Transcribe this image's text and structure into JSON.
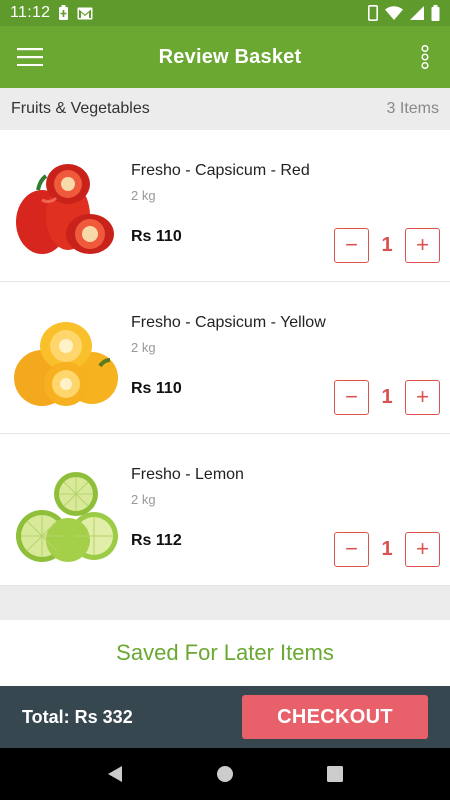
{
  "status_bar": {
    "time": "11:12",
    "icons": [
      "battery-saver-icon",
      "gmail-icon",
      "phone-icon",
      "wifi-icon",
      "signal-icon",
      "battery-icon"
    ]
  },
  "app_bar": {
    "title": "Review Basket",
    "menu_icon": "hamburger-menu-icon",
    "more_icon": "overflow-menu-icon"
  },
  "section": {
    "title": "Fruits & Vegetables",
    "count": "3 Items"
  },
  "items": [
    {
      "name": "Fresho - Capsicum - Red",
      "qty": "2 kg",
      "price": "Rs 110",
      "quantity": "1",
      "image": "red-capsicum-image"
    },
    {
      "name": "Fresho - Capsicum - Yellow",
      "qty": "2 kg",
      "price": "Rs 110",
      "quantity": "1",
      "image": "yellow-capsicum-image"
    },
    {
      "name": "Fresho - Lemon",
      "qty": "2 kg",
      "price": "Rs 112",
      "quantity": "1",
      "image": "lemon-image"
    }
  ],
  "stepper": {
    "minus": "−",
    "plus": "+"
  },
  "saved_for_later": "Saved For Later Items",
  "footer": {
    "total": "Total: Rs 332",
    "checkout": "CHECKOUT"
  },
  "colors": {
    "status_bar": "#5f9b2c",
    "app_bar": "#6aa832",
    "accent_red": "#d9534f",
    "checkout": "#e8606a",
    "footer": "#37474f"
  }
}
